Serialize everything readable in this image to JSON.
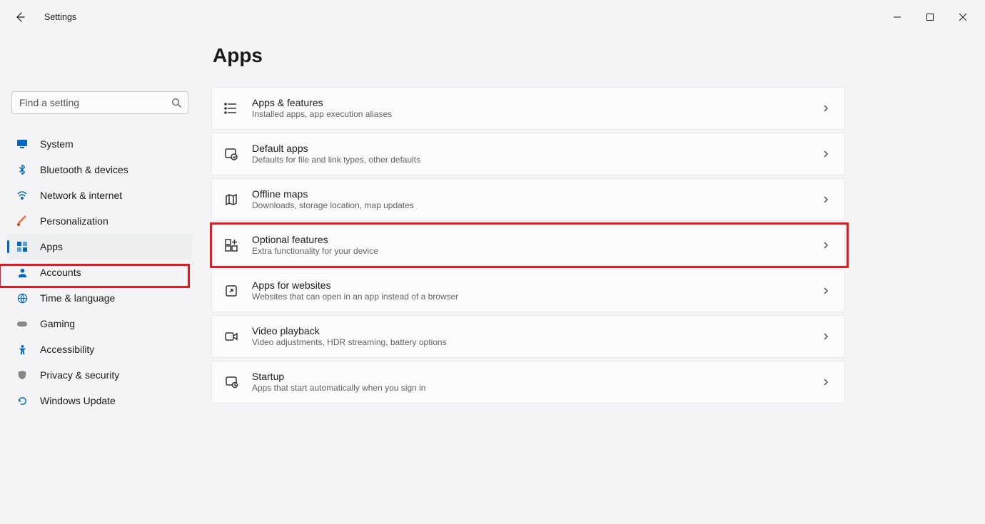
{
  "window": {
    "title": "Settings"
  },
  "search": {
    "placeholder": "Find a setting"
  },
  "sidebar": {
    "items": [
      {
        "label": "System"
      },
      {
        "label": "Bluetooth & devices"
      },
      {
        "label": "Network & internet"
      },
      {
        "label": "Personalization"
      },
      {
        "label": "Apps"
      },
      {
        "label": "Accounts"
      },
      {
        "label": "Time & language"
      },
      {
        "label": "Gaming"
      },
      {
        "label": "Accessibility"
      },
      {
        "label": "Privacy & security"
      },
      {
        "label": "Windows Update"
      }
    ]
  },
  "page": {
    "title": "Apps"
  },
  "cards": [
    {
      "title": "Apps & features",
      "desc": "Installed apps, app execution aliases"
    },
    {
      "title": "Default apps",
      "desc": "Defaults for file and link types, other defaults"
    },
    {
      "title": "Offline maps",
      "desc": "Downloads, storage location, map updates"
    },
    {
      "title": "Optional features",
      "desc": "Extra functionality for your device"
    },
    {
      "title": "Apps for websites",
      "desc": "Websites that can open in an app instead of a browser"
    },
    {
      "title": "Video playback",
      "desc": "Video adjustments, HDR streaming, battery options"
    },
    {
      "title": "Startup",
      "desc": "Apps that start automatically when you sign in"
    }
  ]
}
